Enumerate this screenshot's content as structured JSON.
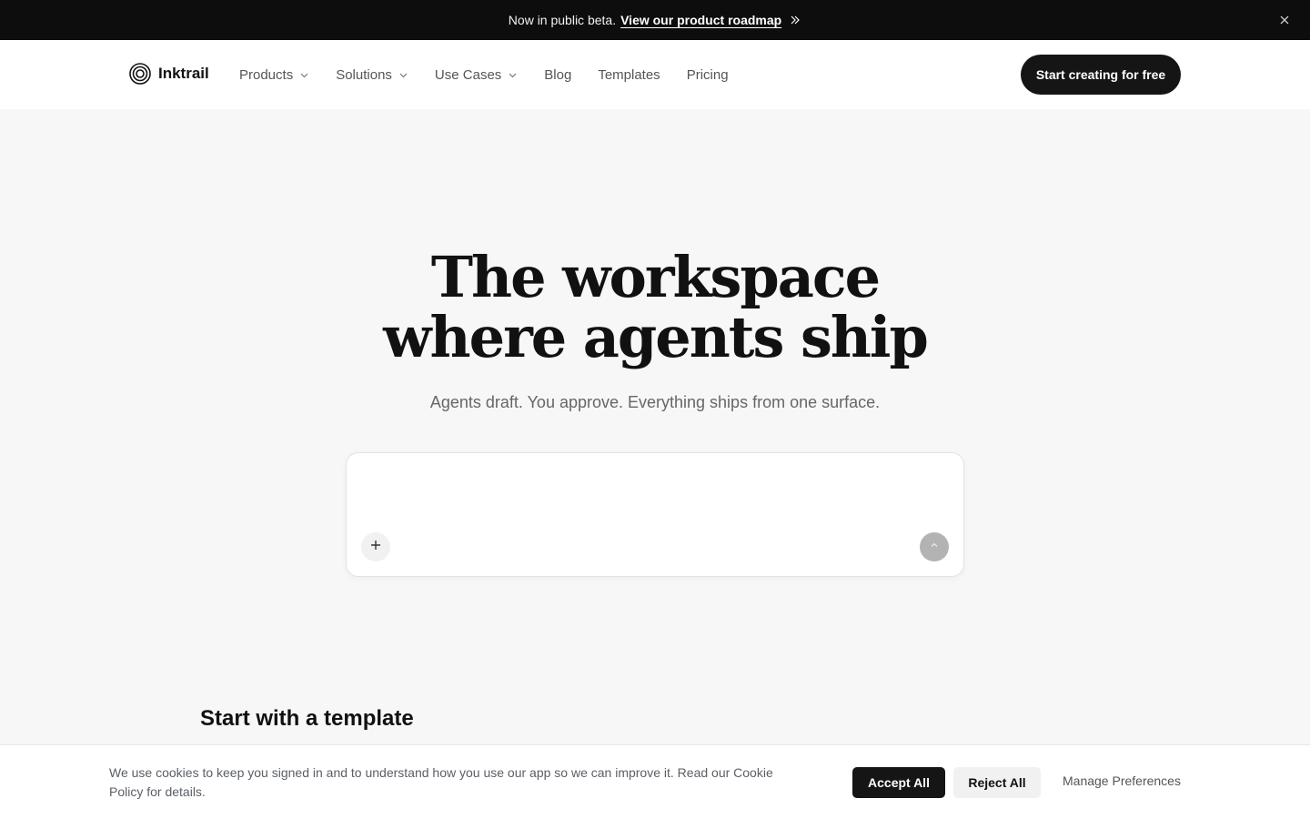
{
  "announcement": {
    "text": "Now in public beta.",
    "link_label": "View our product roadmap"
  },
  "header": {
    "brand": "Inktrail",
    "nav": [
      {
        "label": "Products",
        "has_dropdown": true
      },
      {
        "label": "Solutions",
        "has_dropdown": true
      },
      {
        "label": "Use Cases",
        "has_dropdown": true
      },
      {
        "label": "Blog",
        "has_dropdown": false
      },
      {
        "label": "Templates",
        "has_dropdown": false
      },
      {
        "label": "Pricing",
        "has_dropdown": false
      }
    ],
    "cta_label": "Start creating for free"
  },
  "hero": {
    "title_line1": "The workspace",
    "title_line2": "where agents ship",
    "subtitle": "Agents draft. You approve. Everything ships from one surface.",
    "prompt_value": ""
  },
  "templates": {
    "heading": "Start with a template"
  },
  "cookie": {
    "message": "We use cookies to keep you signed in and to understand how you use our app so we can improve it. Read our Cookie Policy for details.",
    "accept_label": "Accept All",
    "reject_label": "Reject All",
    "manage_label": "Manage Preferences"
  },
  "colors": {
    "announcement_bg": "#0d0d0d",
    "primary_button": "#151515",
    "page_bg": "#f7f7f7",
    "send_button_disabled": "#b3b3b3"
  },
  "icons": [
    "double-chevron-right-icon",
    "close-icon",
    "inktrail-logo-icon",
    "chevron-down-icon",
    "plus-icon",
    "arrow-up-icon"
  ]
}
